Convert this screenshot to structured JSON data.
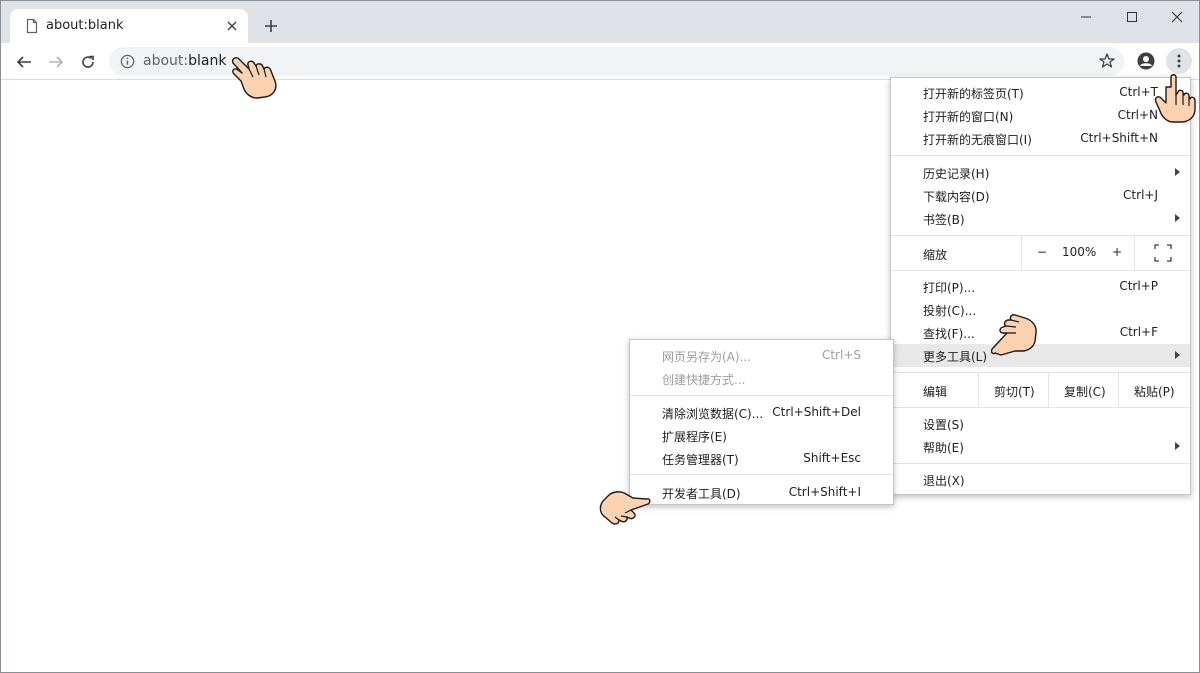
{
  "tab": {
    "title": "about:blank",
    "favicon": "page-icon",
    "close": "close-icon"
  },
  "toolbar": {
    "url_scheme": "about:",
    "url_host": "blank",
    "zoom_level": "100%"
  },
  "main_menu": {
    "new_tab": {
      "label": "打开新的标签页(T)",
      "shortcut": "Ctrl+T"
    },
    "new_window": {
      "label": "打开新的窗口(N)",
      "shortcut": "Ctrl+N"
    },
    "new_incognito": {
      "label": "打开新的无痕窗口(I)",
      "shortcut": "Ctrl+Shift+N"
    },
    "history": {
      "label": "历史记录(H)"
    },
    "downloads": {
      "label": "下载内容(D)",
      "shortcut": "Ctrl+J"
    },
    "bookmarks": {
      "label": "书签(B)"
    },
    "zoom": {
      "label": "缩放",
      "minus": "−",
      "value": "100%",
      "plus": "+"
    },
    "print": {
      "label": "打印(P)...",
      "shortcut": "Ctrl+P"
    },
    "cast": {
      "label": "投射(C)..."
    },
    "find": {
      "label": "查找(F)...",
      "shortcut": "Ctrl+F"
    },
    "more_tools": {
      "label": "更多工具(L)"
    },
    "edit": {
      "label": "编辑",
      "cut": "剪切(T)",
      "copy": "复制(C)",
      "paste": "粘贴(P)"
    },
    "settings": {
      "label": "设置(S)"
    },
    "help": {
      "label": "帮助(E)"
    },
    "exit": {
      "label": "退出(X)"
    }
  },
  "sub_menu": {
    "save_as": {
      "label": "网页另存为(A)...",
      "shortcut": "Ctrl+S"
    },
    "create_shortcut": {
      "label": "创建快捷方式..."
    },
    "clear_data": {
      "label": "清除浏览数据(C)...",
      "shortcut": "Ctrl+Shift+Del"
    },
    "extensions": {
      "label": "扩展程序(E)"
    },
    "task_manager": {
      "label": "任务管理器(T)",
      "shortcut": "Shift+Esc"
    },
    "dev_tools": {
      "label": "开发者工具(D)",
      "shortcut": "Ctrl+Shift+I"
    }
  },
  "colors": {
    "tabstrip": "#dee1e6",
    "omnibox": "#f1f3f4",
    "highlight": "#e8e8e8",
    "hand": "#fcd2b0"
  }
}
